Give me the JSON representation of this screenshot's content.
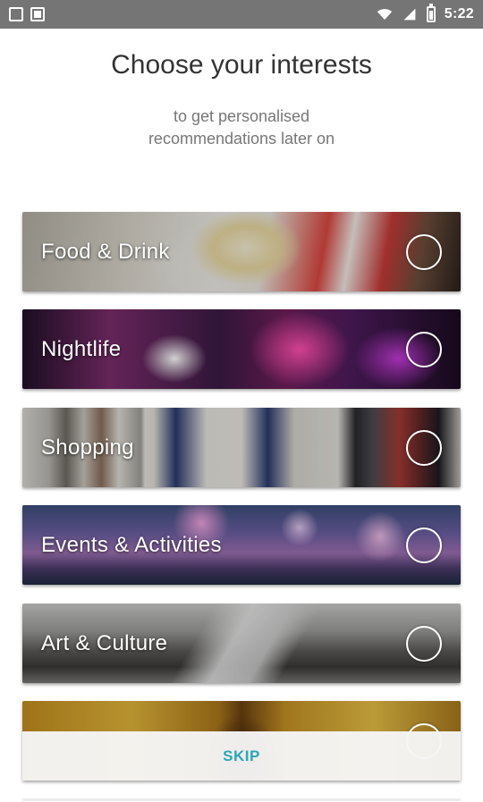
{
  "status_bar": {
    "time": "5:22",
    "left_icons": [
      "app-notification-icon",
      "app-notification-icon"
    ],
    "right_icons": [
      "wifi-icon",
      "signal-icon",
      "battery-icon"
    ]
  },
  "header": {
    "title": "Choose your interests",
    "subtitle": "to get personalised recommendations later on"
  },
  "interests": [
    {
      "label": "Food & Drink",
      "selected": false
    },
    {
      "label": "Nightlife",
      "selected": false
    },
    {
      "label": "Shopping",
      "selected": false
    },
    {
      "label": "Events & Activities",
      "selected": false
    },
    {
      "label": "Art & Culture",
      "selected": false
    },
    {
      "label": "",
      "selected": false
    }
  ],
  "footer": {
    "skip_label": "SKIP"
  },
  "colors": {
    "status_bar": "#757575",
    "skip_text": "#2aa7b8",
    "title_text": "#333333",
    "subtitle_text": "#777777"
  }
}
